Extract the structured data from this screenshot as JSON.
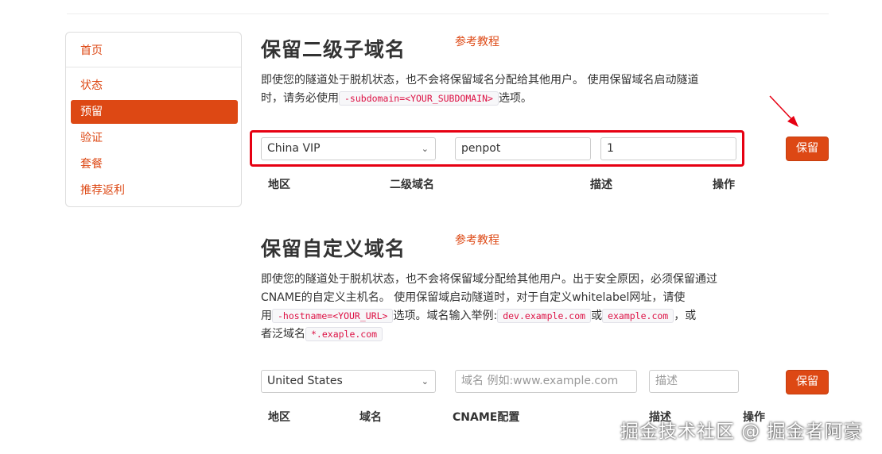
{
  "sidebar": {
    "items": [
      {
        "label": "首页"
      },
      {
        "label": "状态"
      },
      {
        "label": "预留"
      },
      {
        "label": "验证"
      },
      {
        "label": "套餐"
      },
      {
        "label": "推荐返利"
      }
    ]
  },
  "subdomain_section": {
    "title": "保留二级子域名",
    "ref_link": "参考教程",
    "desc_1": "即使您的隧道处于脱机状态，也不会将保留域名分配给其他用户。 使用保留域名启动隧道",
    "desc_2a": "时，请务必使用",
    "desc_code": "-subdomain=<YOUR_SUBDOMAIN>",
    "desc_2b": "选项。",
    "region_value": "China VIP",
    "subdomain_value": "penpot",
    "description_value": "1",
    "save_label": "保留",
    "columns": [
      "地区",
      "二级域名",
      "描述",
      "操作"
    ]
  },
  "custom_section": {
    "title": "保留自定义域名",
    "ref_link": "参考教程",
    "desc_1": "即使您的隧道处于脱机状态，也不会将保留域分配给其他用户。出于安全原因，必须保留通过",
    "desc_2": "CNAME的自定义主机名。 使用保留域启动隧道时，对于自定义whitelabel网址，请使",
    "desc_3a": "用",
    "desc_code1": "-hostname=<YOUR_URL>",
    "desc_3b": "选项。域名输入举例:",
    "desc_code2": "dev.example.com",
    "desc_3c": "或",
    "desc_code3": "example.com",
    "desc_3d": "，或",
    "desc_4a": "者泛域名",
    "desc_code4": "*.exaple.com",
    "region_value": "United States",
    "domain_placeholder": "域名 例如:www.example.com",
    "description_placeholder": "描述",
    "save_label": "保留",
    "columns": [
      "地区",
      "域名",
      "CNAME配置",
      "描述",
      "操作"
    ]
  },
  "watermark": "掘金技术社区 @ 掘金者阿豪",
  "colors": {
    "accent": "#dd4814",
    "highlight_box": "#e60012",
    "arrow": "#e60012"
  },
  "icons": {
    "select_chevron": "chevron-down-icon",
    "annotation_arrow": "arrow-icon"
  }
}
